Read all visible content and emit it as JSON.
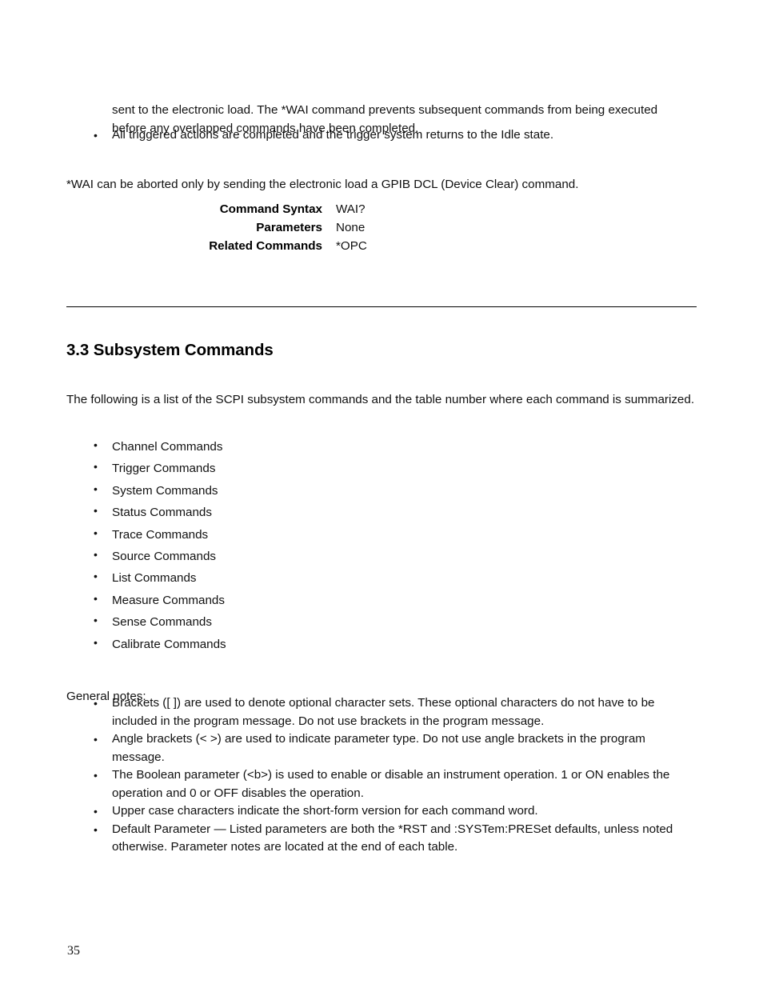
{
  "document": {
    "page_number": "35"
  },
  "continuation_paragraph": "sent to the electronic load. The *WAI command prevents subsequent commands from being executed before any overlapped commands have been completed.",
  "trigger_bullet": "All triggered actions are completed and the trigger system returns to the Idle state.",
  "abort_paragraph": "*WAI can be aborted only by sending the electronic load a GPIB DCL (Device Clear) command.",
  "command_block": {
    "rows": [
      {
        "label": "Command Syntax",
        "value": "WAI?"
      },
      {
        "label": "Parameters",
        "value": "None"
      },
      {
        "label": "Related Commands",
        "value": "*OPC"
      }
    ]
  },
  "section": {
    "heading": "3.3 Subsystem Commands",
    "intro": "The following is a list of the SCPI subsystem commands and the table number where each command is summarized.",
    "subsystem_commands": [
      "Channel Commands",
      "Trigger Commands",
      "System Commands",
      "Status Commands",
      "Trace Commands",
      "Source Commands",
      "List Commands",
      "Measure Commands",
      "Sense Commands",
      "Calibrate Commands"
    ]
  },
  "general_notes": {
    "label": "General notes:",
    "items": [
      "Brackets ([ ]) are used to denote optional character sets. These optional characters do not have to be included in the program message. Do not use brackets in the program message.",
      "Angle brackets (< >) are used to indicate parameter type. Do not use angle brackets in the program message.",
      "The Boolean parameter (<b>) is used to enable or disable an instrument operation. 1 or ON enables the operation and 0 or OFF disables the operation.",
      "Upper case characters indicate the short-form version for each command word.",
      "Default Parameter — Listed parameters are both the *RST and :SYSTem:PRESet defaults, unless noted otherwise. Parameter notes are located at the end of each table."
    ]
  }
}
